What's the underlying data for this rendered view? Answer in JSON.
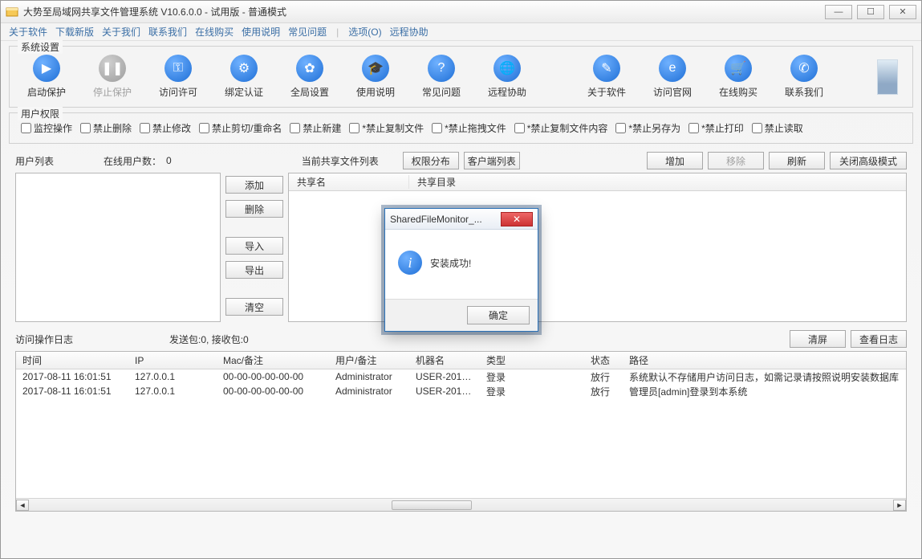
{
  "title": "大势至局域网共享文件管理系统 V10.6.0.0 - 试用版 - 普通模式",
  "menubar": [
    "关于软件",
    "下载新版",
    "关于我们",
    "联系我们",
    "在线购买",
    "使用说明",
    "常见问题"
  ],
  "menubar_right": [
    "选项(O)",
    "远程协助"
  ],
  "sections": {
    "system_settings": "系统设置",
    "user_perm": "用户权限"
  },
  "toolbar": [
    {
      "name": "start-protect",
      "label": "启动保护",
      "glyph": "▶"
    },
    {
      "name": "stop-protect",
      "label": "停止保护",
      "glyph": "❚❚",
      "disabled": true
    },
    {
      "name": "access-permit",
      "label": "访问许可",
      "glyph": "⚿"
    },
    {
      "name": "bind-auth",
      "label": "绑定认证",
      "glyph": "⚙"
    },
    {
      "name": "global-settings",
      "label": "全局设置",
      "glyph": "✿"
    },
    {
      "name": "usage",
      "label": "使用说明",
      "glyph": "🎓"
    },
    {
      "name": "faq",
      "label": "常见问题",
      "glyph": "?"
    },
    {
      "name": "remote-assist",
      "label": "远程协助",
      "glyph": "🌐"
    },
    {
      "name": "about-soft",
      "label": "关于软件",
      "glyph": "✎"
    },
    {
      "name": "visit-site",
      "label": "访问官网",
      "glyph": "e"
    },
    {
      "name": "buy-online",
      "label": "在线购买",
      "glyph": "🛒"
    },
    {
      "name": "contact-us",
      "label": "联系我们",
      "glyph": "✆"
    }
  ],
  "perm_checks": [
    "监控操作",
    "禁止删除",
    "禁止修改",
    "禁止剪切/重命名",
    "禁止新建",
    "*禁止复制文件",
    "*禁止拖拽文件",
    "*禁止复制文件内容",
    "*禁止另存为",
    "*禁止打印",
    "禁止读取"
  ],
  "labels": {
    "user_list": "用户列表",
    "online_users": "在线用户数：",
    "online_count": "0",
    "share_list": "当前共享文件列表",
    "perm_dist": "权限分布",
    "client_list": "客户端列表",
    "add": "增加",
    "remove": "移除",
    "refresh": "刷新",
    "close_adv": "关闭高级模式",
    "side": {
      "add": "添加",
      "del": "删除",
      "imp": "导入",
      "exp": "导出",
      "clr": "清空"
    },
    "share_cols": {
      "name": "共享名",
      "dir": "共享目录"
    },
    "log_title": "访问操作日志",
    "packets": "发送包:0, 接收包:0",
    "clear_screen": "清屏",
    "view_log": "查看日志",
    "cols": {
      "time": "时间",
      "ip": "IP",
      "mac": "Mac/备注",
      "user": "用户/备注",
      "machine": "机器名",
      "type": "类型",
      "status": "状态",
      "path": "路径"
    }
  },
  "logs": [
    {
      "time": "2017-08-11 16:01:51",
      "ip": "127.0.0.1",
      "mac": "00-00-00-00-00-00",
      "user": "Administrator",
      "machine": "USER-2017...",
      "type": "登录",
      "status": "放行",
      "path": "系统默认不存储用户访问日志，如需记录请按照说明安装数据库"
    },
    {
      "time": "2017-08-11 16:01:51",
      "ip": "127.0.0.1",
      "mac": "00-00-00-00-00-00",
      "user": "Administrator",
      "machine": "USER-2017...",
      "type": "登录",
      "status": "放行",
      "path": "管理员[admin]登录到本系统"
    }
  ],
  "modal": {
    "title": "SharedFileMonitor_...",
    "message": "安装成功!",
    "ok": "确定"
  }
}
